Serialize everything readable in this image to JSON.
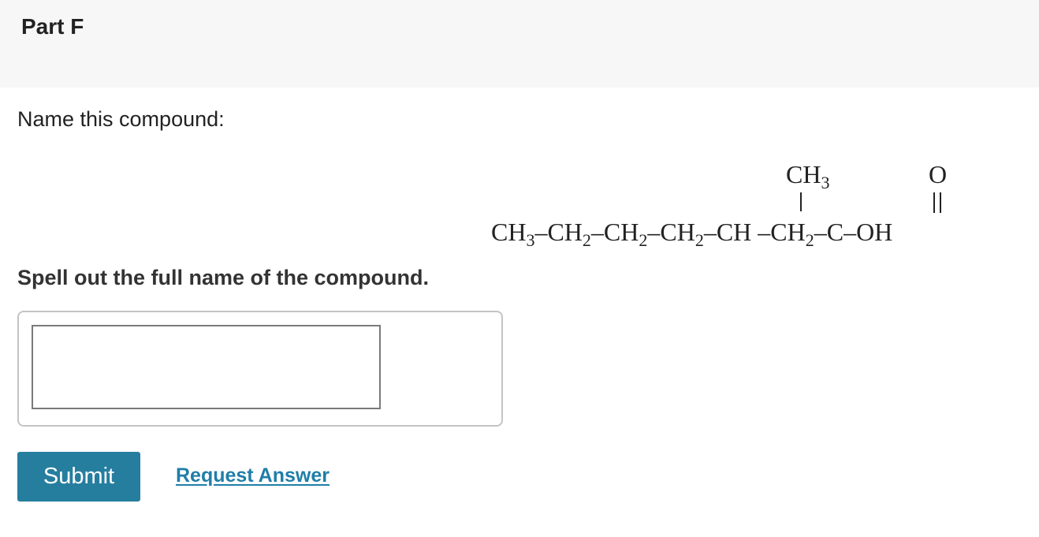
{
  "header": {
    "part_title": "Part F"
  },
  "question": {
    "prompt": "Name this compound:",
    "instruction": "Spell out the full name of the compound."
  },
  "structure": {
    "branch_label": "CH3",
    "carbonyl_oxygen": "O",
    "chain": {
      "group1": "CH3",
      "group2": "CH2",
      "group3": "CH2",
      "group4": "CH2",
      "group5": "CH",
      "group6": "CH2",
      "group7": "C",
      "group8": "OH"
    },
    "bond": "–"
  },
  "answer": {
    "value": "",
    "placeholder": ""
  },
  "actions": {
    "submit_label": "Submit",
    "request_answer_label": "Request Answer"
  },
  "colors": {
    "header_bg": "#f7f7f7",
    "submit_bg": "#267e9f",
    "link": "#1f7ea8"
  }
}
